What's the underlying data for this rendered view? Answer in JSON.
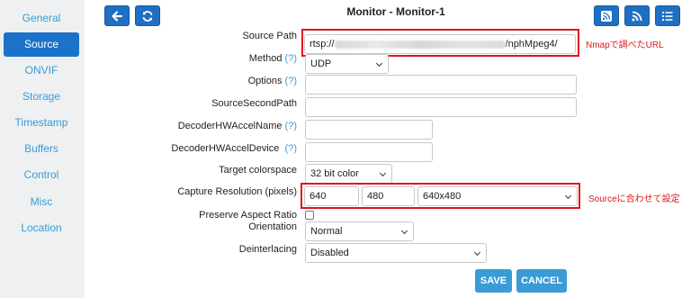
{
  "sidebar": {
    "tabs": [
      "General",
      "Source",
      "ONVIF",
      "Storage",
      "Timestamp",
      "Buffers",
      "Control",
      "Misc",
      "Location"
    ],
    "active": "Source"
  },
  "header": {
    "title": "Monitor - Monitor-1"
  },
  "form": {
    "source_path": {
      "label": "Source Path",
      "value_prefix": "rtsp://",
      "value_suffix": "/nphMpeg4/"
    },
    "method": {
      "label": "Method",
      "help": "(?)",
      "value": "UDP"
    },
    "options": {
      "label": "Options",
      "help": "(?)",
      "value": ""
    },
    "source_second_path": {
      "label": "SourceSecondPath",
      "value": ""
    },
    "decoder_hw_accel_name": {
      "label": "DecoderHWAccelName",
      "help": "(?)",
      "value": ""
    },
    "decoder_hw_accel_device": {
      "label": "DecoderHWAccelDevice",
      "help": "(?)",
      "value": ""
    },
    "target_colorspace": {
      "label": "Target colorspace",
      "value": "32 bit color"
    },
    "capture_resolution": {
      "label": "Capture Resolution (pixels)",
      "width": "640",
      "height": "480",
      "preset": "640x480"
    },
    "preserve_aspect_ratio": {
      "label": "Preserve Aspect Ratio",
      "checked": false
    },
    "orientation": {
      "label": "Orientation",
      "value": "Normal"
    },
    "deinterlacing": {
      "label": "Deinterlacing",
      "value": "Disabled"
    }
  },
  "annotations": {
    "source_note": "Nmapで調べたURL",
    "resolution_note": "Sourceに合わせて設定"
  },
  "buttons": {
    "save": "SAVE",
    "cancel": "CANCEL"
  },
  "icons": [
    "back-arrow-icon",
    "refresh-icon",
    "rss-icon",
    "rss-icon",
    "list-icon"
  ],
  "colors": {
    "accent": "#1f6fc2",
    "link": "#3a9bd6",
    "annotation": "#e0151b",
    "active_tab": "#1a73c9"
  }
}
